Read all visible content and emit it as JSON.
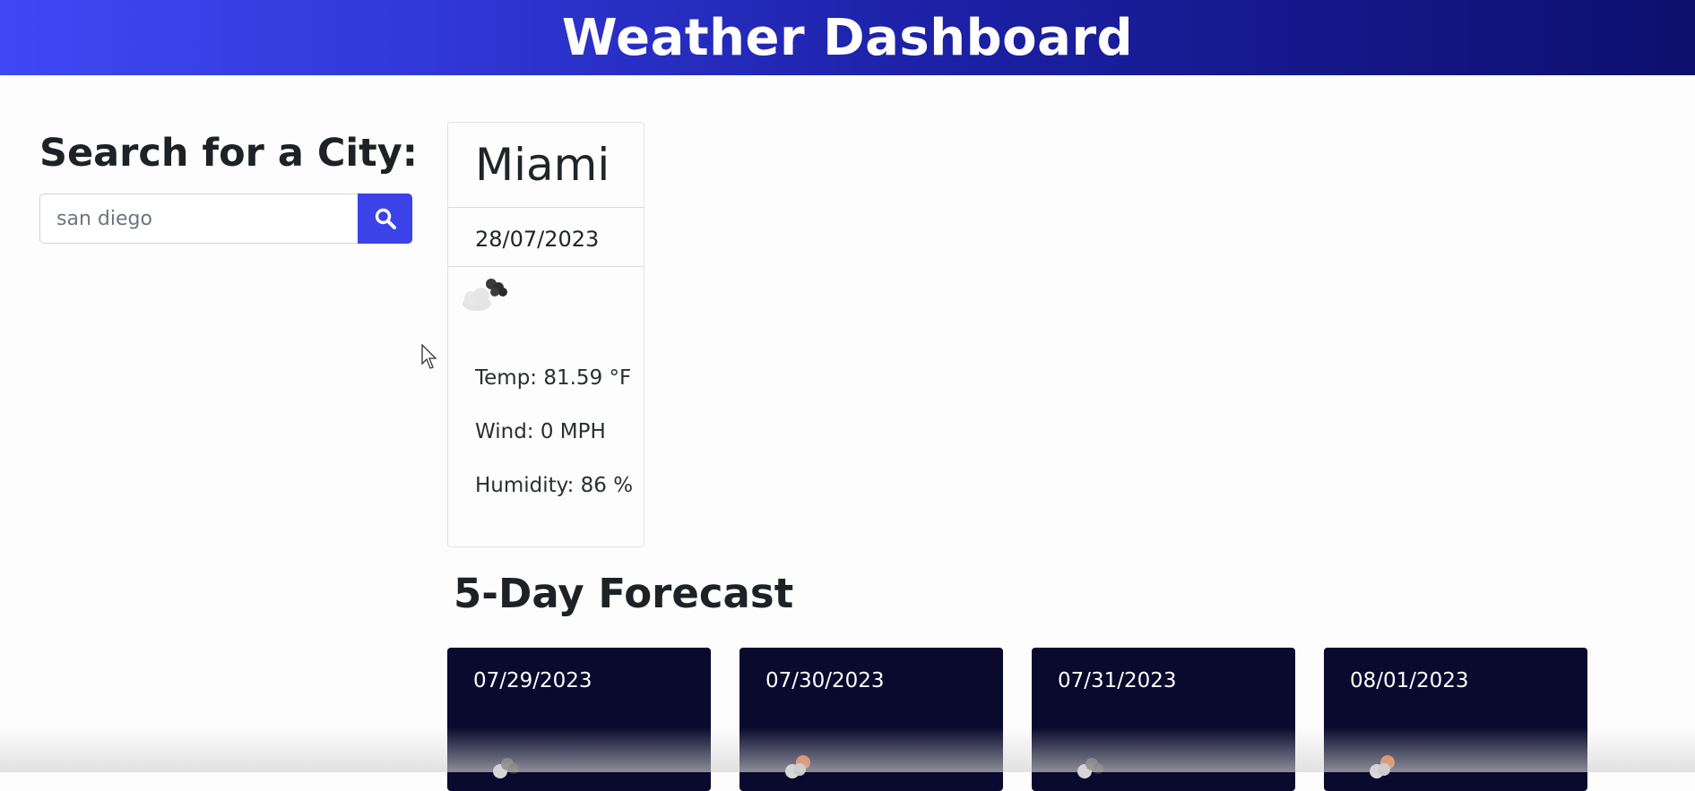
{
  "header": {
    "title": "Weather Dashboard"
  },
  "search": {
    "heading": "Search for a City:",
    "input_value": "san diego",
    "button_icon": "search-icon"
  },
  "current": {
    "city": "Miami",
    "date": "28/07/2023",
    "icon": "cloud-icon",
    "temp": "Temp: 81.59 °F",
    "wind": "Wind: 0 MPH",
    "humidity": "Humidity: 86 %"
  },
  "forecast": {
    "heading": "5-Day Forecast",
    "days": [
      {
        "date": "07/29/2023",
        "icon": "cloud-icon"
      },
      {
        "date": "07/30/2023",
        "icon": "sun-cloud-icon"
      },
      {
        "date": "07/31/2023",
        "icon": "cloud-icon"
      },
      {
        "date": "08/01/2023",
        "icon": "sun-cloud-icon"
      }
    ]
  },
  "colors": {
    "header_start": "#3f48f4",
    "header_end": "#0d0f6e",
    "search_button": "#3b42e8",
    "forecast_card": "#0a0a2e"
  }
}
